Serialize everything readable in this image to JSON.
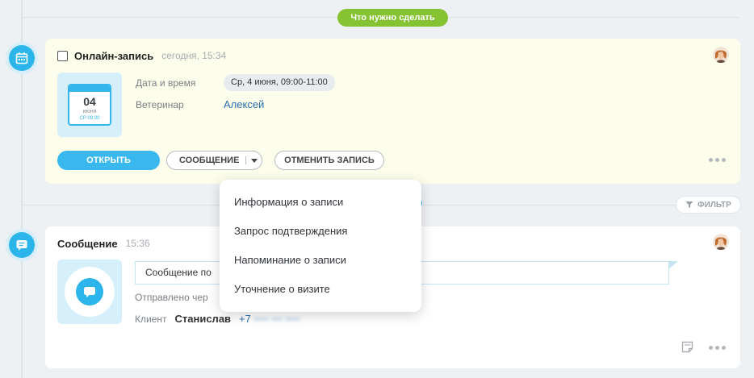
{
  "divider": {
    "label": "Что нужно сделать"
  },
  "appointment": {
    "title": "Онлайн-запись",
    "time": "сегодня, 15:34",
    "calendar": {
      "day": "04",
      "month": "июня",
      "sub": "СР 09:00"
    },
    "fields": {
      "datetime_label": "Дата и время",
      "datetime_value": "Ср, 4 июня, 09:00-11:00",
      "vet_label": "Ветеринар",
      "vet_value": "Алексей"
    },
    "buttons": {
      "open": "Открыть",
      "message": "Сообщение",
      "cancel": "Отменить запись"
    }
  },
  "filter": {
    "label": "Фильтр"
  },
  "message_card": {
    "title": "Сообщение",
    "time": "15:36",
    "text": "Сообщение по",
    "sent_label": "Отправлено чер",
    "client_label": "Клиент",
    "client_name": "Станислав",
    "client_phone": "+7",
    "client_phone_hidden": "•••• ••• ••••"
  },
  "dropdown": {
    "items": [
      "Информация о записи",
      "Запрос подтверждения",
      "Напоминание о записи",
      "Уточнение о визите"
    ]
  },
  "colors": {
    "accent": "#39b8ee",
    "todo": "#86c332",
    "link": "#2a6fb0"
  }
}
